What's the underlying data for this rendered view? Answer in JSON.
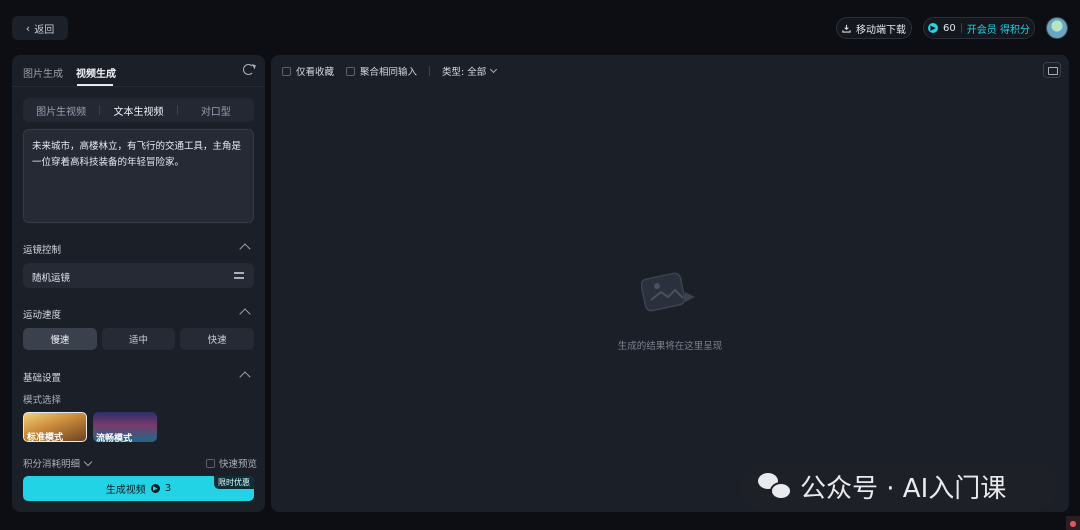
{
  "header": {
    "back_label": "返回",
    "download_label": "移动端下载",
    "credits": "60",
    "vip_label": "开会员 得积分"
  },
  "left": {
    "top_tabs": [
      {
        "label": "图片生成",
        "active": false
      },
      {
        "label": "视频生成",
        "active": true
      }
    ],
    "modes": [
      {
        "label": "图片生视频",
        "active": false
      },
      {
        "label": "文本生视频",
        "active": true
      },
      {
        "label": "对口型",
        "active": false
      }
    ],
    "prompt": "未来城市，高楼林立，有飞行的交通工具，主角是一位穿着高科技装备的年轻冒险家。",
    "camera_section": "运镜控制",
    "camera_value": "随机运镜",
    "speed_section": "运动速度",
    "speeds": [
      {
        "label": "慢速",
        "active": true
      },
      {
        "label": "适中",
        "active": false
      },
      {
        "label": "快速",
        "active": false
      }
    ],
    "basic_section": "基础设置",
    "mode_select_label": "模式选择",
    "mode_options": [
      {
        "label": "标准模式",
        "selected": true
      },
      {
        "label": "流畅模式",
        "selected": false
      }
    ],
    "credit_detail": "积分消耗明细",
    "fast_preview": "快速预览",
    "generate_label": "生成视频",
    "generate_cost": "3",
    "promo_badge": "限时优惠"
  },
  "right": {
    "favorites_only": "仅看收藏",
    "merge_inputs": "聚合相同输入",
    "type_filter": "类型: 全部",
    "empty_text": "生成的结果将在这里呈现"
  },
  "watermark": {
    "text": "公众号 · AI入门课"
  },
  "colors": {
    "accent": "#22d3e6",
    "panel": "#1b1f27",
    "background": "#0c0e13"
  }
}
